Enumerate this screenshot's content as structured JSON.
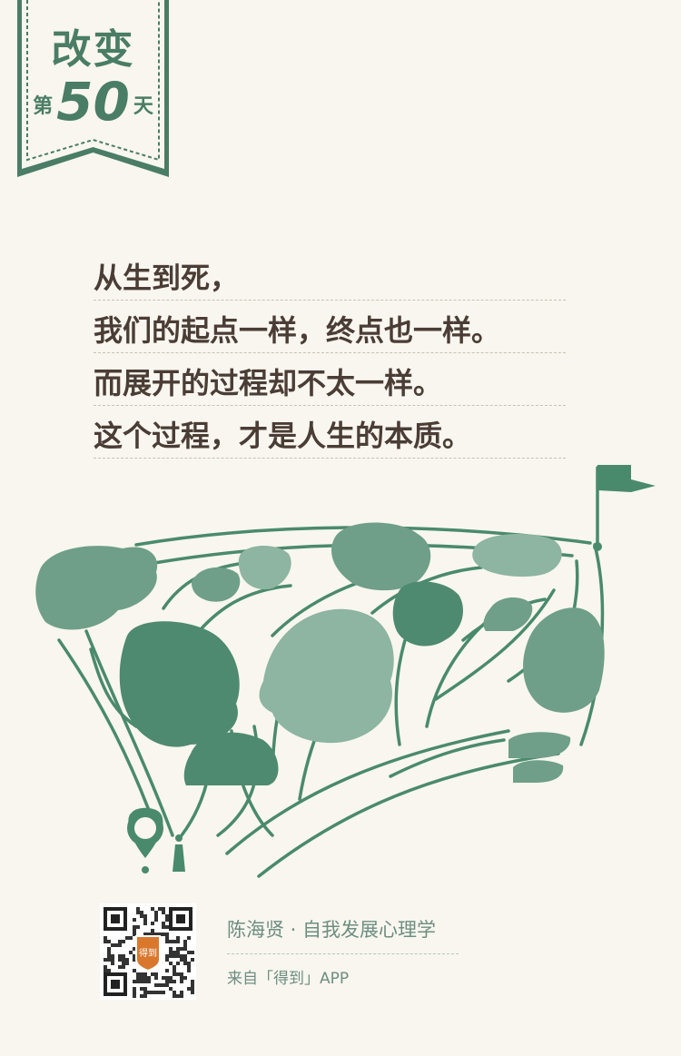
{
  "badge": {
    "title": "改变",
    "day_prefix": "第",
    "day_number": "50",
    "day_suffix": "天"
  },
  "quote": {
    "lines": [
      "从生到死，",
      "我们的起点一样，终点也一样。",
      "而展开的过程却不太一样。",
      "这个过程，才是人生的本质。"
    ]
  },
  "illustration": {
    "start_marker_icon": "location-pin-icon",
    "finish_marker_icon": "flag-icon",
    "colors": {
      "path": "#4a8a6c",
      "tree_dark": "#4e8a6f",
      "tree_mid": "#6f9f88",
      "tree_light": "#8db5a1"
    }
  },
  "footer": {
    "author": "陈海贤 · 自我发展心理学",
    "source": "来自「得到」APP",
    "qr_icon": "qr-code-icon",
    "logo_text": "得到"
  }
}
